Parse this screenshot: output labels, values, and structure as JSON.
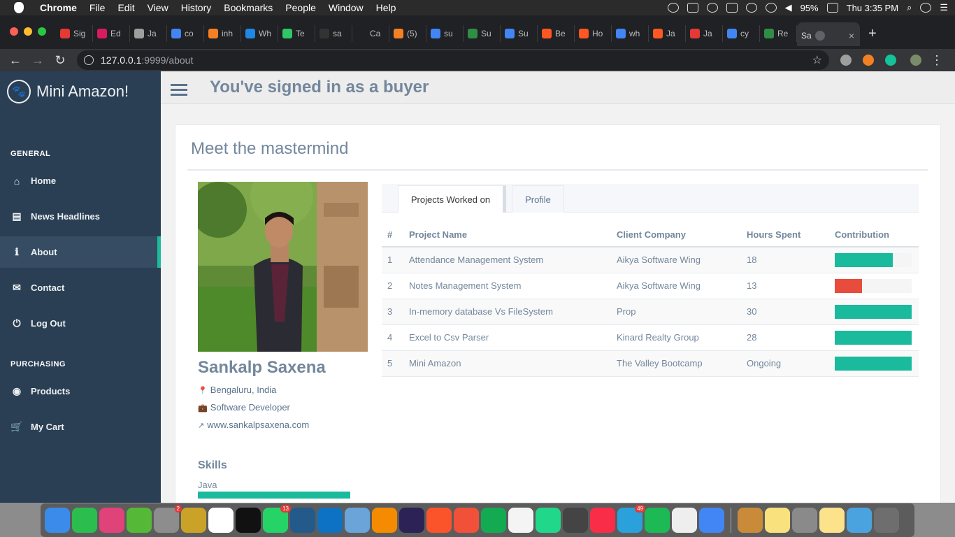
{
  "menubar": {
    "app": "Chrome",
    "items": [
      "File",
      "Edit",
      "View",
      "History",
      "Bookmarks",
      "People",
      "Window",
      "Help"
    ],
    "battery": "95%",
    "clock": "Thu 3:35 PM"
  },
  "tabs": [
    {
      "label": "Sig",
      "color": "#e53935"
    },
    {
      "label": "Ed",
      "color": "#d81b60"
    },
    {
      "label": "Ja",
      "color": "#9e9e9e"
    },
    {
      "label": "co",
      "color": "#4285f4"
    },
    {
      "label": "inh",
      "color": "#f48024"
    },
    {
      "label": "Wh",
      "color": "#1e88e5"
    },
    {
      "label": "Te",
      "color": "#2ec866"
    },
    {
      "label": "sa",
      "color": "#333333"
    },
    {
      "label": "Ca",
      "color": "#202124"
    },
    {
      "label": "(5)",
      "color": "#f48024"
    },
    {
      "label": "su",
      "color": "#4285f4"
    },
    {
      "label": "Su",
      "color": "#2f8d46"
    },
    {
      "label": "Su",
      "color": "#4285f4"
    },
    {
      "label": "Be",
      "color": "#ff5722"
    },
    {
      "label": "Ho",
      "color": "#ff5722"
    },
    {
      "label": "wh",
      "color": "#4285f4"
    },
    {
      "label": "Ja",
      "color": "#ff5722"
    },
    {
      "label": "Ja",
      "color": "#e53935"
    },
    {
      "label": "cy",
      "color": "#4285f4"
    },
    {
      "label": "Re",
      "color": "#2f8d46"
    }
  ],
  "active_tab": {
    "label": "Sa",
    "close": "×"
  },
  "new_tab": "+",
  "url": {
    "host": "127.0.0.1",
    "path": ":9999/about"
  },
  "sidebar": {
    "brand": "Mini Amazon!",
    "general_title": "GENERAL",
    "general_items": [
      {
        "label": "Home",
        "icon": "home-icon",
        "glyph": "⌂"
      },
      {
        "label": "News Headlines",
        "icon": "newspaper-icon",
        "glyph": "▤"
      },
      {
        "label": "About",
        "icon": "info-icon",
        "glyph": "ℹ"
      },
      {
        "label": "Contact",
        "icon": "envelope-icon",
        "glyph": "✉"
      },
      {
        "label": "Log Out",
        "icon": "power-icon",
        "glyph": "⏻"
      }
    ],
    "purchasing_title": "PURCHASING",
    "purchasing_items": [
      {
        "label": "Products",
        "icon": "products-icon",
        "glyph": "◉"
      },
      {
        "label": "My Cart",
        "icon": "cart-icon",
        "glyph": "🛒"
      }
    ]
  },
  "topnav": {
    "signed_in": "You've signed in as a buyer"
  },
  "panel": {
    "title": "Meet the mastermind",
    "profile": {
      "name": "Sankalp Saxena",
      "location": "Bengaluru, India",
      "job": "Software Developer",
      "website": "www.sankalpsaxena.com"
    },
    "skills_title": "Skills",
    "skills": [
      {
        "name": "Java",
        "level": 1.0
      }
    ],
    "tabs": [
      "Projects Worked on",
      "Profile"
    ],
    "table": {
      "headers": [
        "#",
        "Project Name",
        "Client Company",
        "Hours Spent",
        "Contribution"
      ],
      "rows": [
        {
          "num": "1",
          "project": "Attendance Management System",
          "client": "Aikya Software Wing",
          "hours": "18",
          "contribution": 0.75,
          "color": "#1abb9c"
        },
        {
          "num": "2",
          "project": "Notes Management System",
          "client": "Aikya Software Wing",
          "hours": "13",
          "contribution": 0.35,
          "color": "#e74c3c"
        },
        {
          "num": "3",
          "project": "In-memory database Vs FileSystem",
          "client": "Prop",
          "hours": "30",
          "contribution": 1.0,
          "color": "#1abb9c"
        },
        {
          "num": "4",
          "project": "Excel to Csv Parser",
          "client": "Kinard Realty Group",
          "hours": "28",
          "contribution": 1.0,
          "color": "#1abb9c"
        },
        {
          "num": "5",
          "project": "Mini Amazon",
          "client": "The Valley Bootcamp",
          "hours": "Ongoing",
          "contribution": 1.0,
          "color": "#1abb9c"
        }
      ]
    }
  },
  "dock": {
    "apps": [
      {
        "name": "finder",
        "color": "#3b8beb"
      },
      {
        "name": "facetime",
        "color": "#2bbd4e"
      },
      {
        "name": "screens",
        "color": "#e0427a"
      },
      {
        "name": "utorrent",
        "color": "#55b836"
      },
      {
        "name": "system-preferences",
        "color": "#8d8d8d",
        "badge": "2"
      },
      {
        "name": "cyberduck",
        "color": "#c9a227"
      },
      {
        "name": "slack",
        "color": "#ffffff"
      },
      {
        "name": "terminal",
        "color": "#111111"
      },
      {
        "name": "whatsapp",
        "color": "#25d366",
        "badge": "13"
      },
      {
        "name": "mysql-workbench",
        "color": "#245a8a"
      },
      {
        "name": "vscode",
        "color": "#0e72c4"
      },
      {
        "name": "preview",
        "color": "#6aa4d8"
      },
      {
        "name": "vlc",
        "color": "#f48b00"
      },
      {
        "name": "eclipse",
        "color": "#2c2255"
      },
      {
        "name": "brave",
        "color": "#fb542b"
      },
      {
        "name": "swift",
        "color": "#f05138"
      },
      {
        "name": "mongodb",
        "color": "#13aa52"
      },
      {
        "name": "news",
        "color": "#f4f4f4"
      },
      {
        "name": "pycharm",
        "color": "#21d789"
      },
      {
        "name": "sublime",
        "color": "#444444"
      },
      {
        "name": "music",
        "color": "#fa2d48"
      },
      {
        "name": "telegram",
        "color": "#2aa1da",
        "badge": "49"
      },
      {
        "name": "spotify",
        "color": "#1db954"
      },
      {
        "name": "itunes",
        "color": "#eeeeee"
      },
      {
        "name": "chrome",
        "color": "#4285f4"
      },
      {
        "name": "sequel-pro",
        "color": "#c98b3a"
      },
      {
        "name": "stickies",
        "color": "#f9e27d"
      },
      {
        "name": "firefox-dev",
        "color": "#8a8a8a"
      },
      {
        "name": "notes",
        "color": "#fbe28b"
      },
      {
        "name": "downloads",
        "color": "#4aa3df"
      },
      {
        "name": "trash",
        "color": "#6e6e6e"
      }
    ]
  }
}
